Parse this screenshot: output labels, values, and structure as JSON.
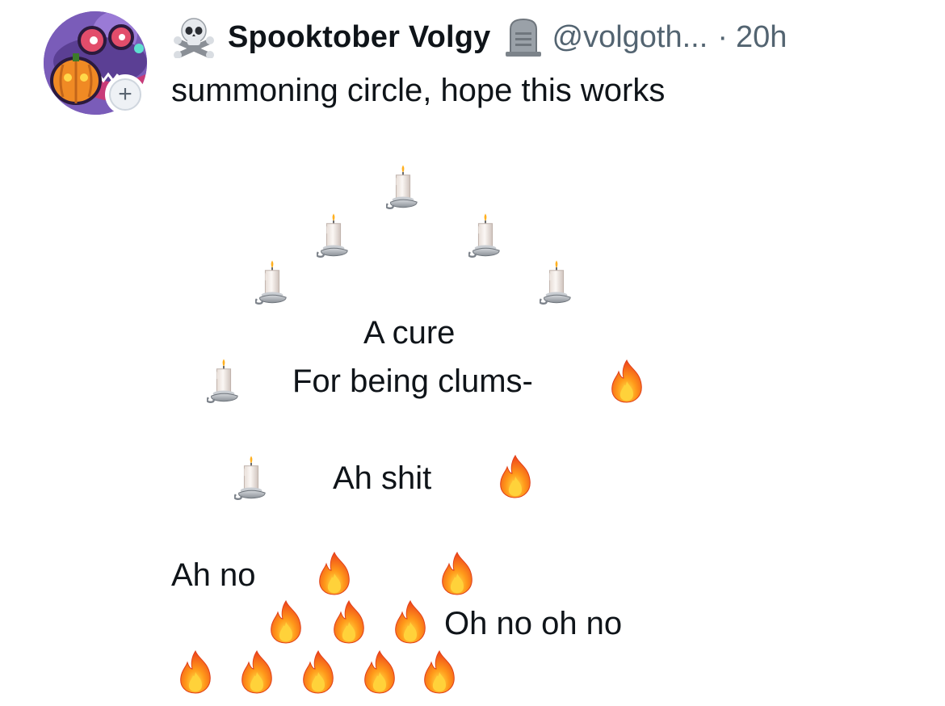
{
  "post": {
    "display_name": "Spooktober Volgy",
    "handle": "@volgoth...",
    "separator": "·",
    "time": "20h",
    "text": "summoning circle, hope this works",
    "follow_symbol": "+"
  },
  "icons": {
    "name_prefix": "skull-crossbones-icon",
    "name_suffix": "headstone-icon",
    "candle": "candle-icon",
    "fire": "fire-icon"
  },
  "poem": {
    "line1": "A cure",
    "line2": "For being clums-",
    "line3": "Ah shit",
    "line4": "Ah no",
    "line5": "Oh no oh no"
  }
}
